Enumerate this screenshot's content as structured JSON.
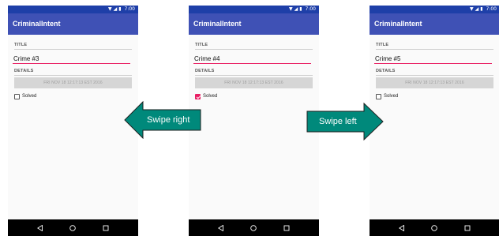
{
  "status_bar": {
    "time": "7:00"
  },
  "app_title": "CriminalIntent",
  "labels": {
    "title": "TITLE",
    "details": "DETAILS",
    "solved": "Solved"
  },
  "screens": [
    {
      "crime_title": "Crime #3",
      "date": "FRI NOV 18 12:17:13 EST 2016",
      "solved": false
    },
    {
      "crime_title": "Crime #4",
      "date": "FRI NOV 18 12:17:13 EST 2016",
      "solved": true
    },
    {
      "crime_title": "Crime #5",
      "date": "FRI NOV 18 12:17:13 EST 2016",
      "solved": false
    }
  ],
  "annotations": {
    "swipe_right": "Swipe right",
    "swipe_left": "Swipe left"
  },
  "colors": {
    "status_bar": "#1e3fa8",
    "app_bar": "#3f51b5",
    "accent": "#e91e63",
    "arrow": "#00897b",
    "nav_bar": "#000000"
  },
  "icons": {
    "status": [
      "wifi-icon",
      "signal-icon",
      "battery-icon"
    ],
    "nav": [
      "back-icon",
      "home-icon",
      "recents-icon"
    ],
    "arrows": [
      "left-arrow-icon",
      "right-arrow-icon"
    ]
  }
}
